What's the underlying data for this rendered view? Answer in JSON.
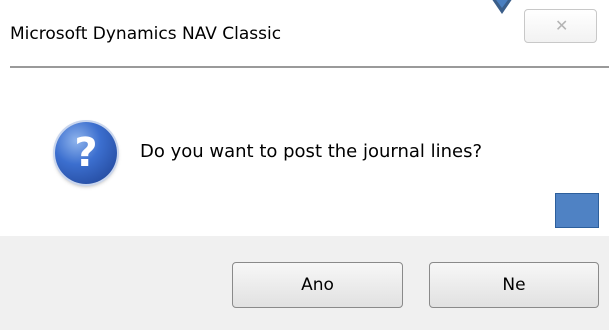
{
  "window": {
    "title": "Microsoft Dynamics NAV Classic",
    "close_glyph": "✕"
  },
  "message": {
    "text": "Do you want to post the journal lines?",
    "icon": "question-icon",
    "icon_glyph": "?"
  },
  "buttons": {
    "yes_label": "Ano",
    "no_label": "Ne"
  },
  "colors": {
    "accent_blue": "#4f82c4",
    "footer_bg": "#f0f0f0"
  }
}
